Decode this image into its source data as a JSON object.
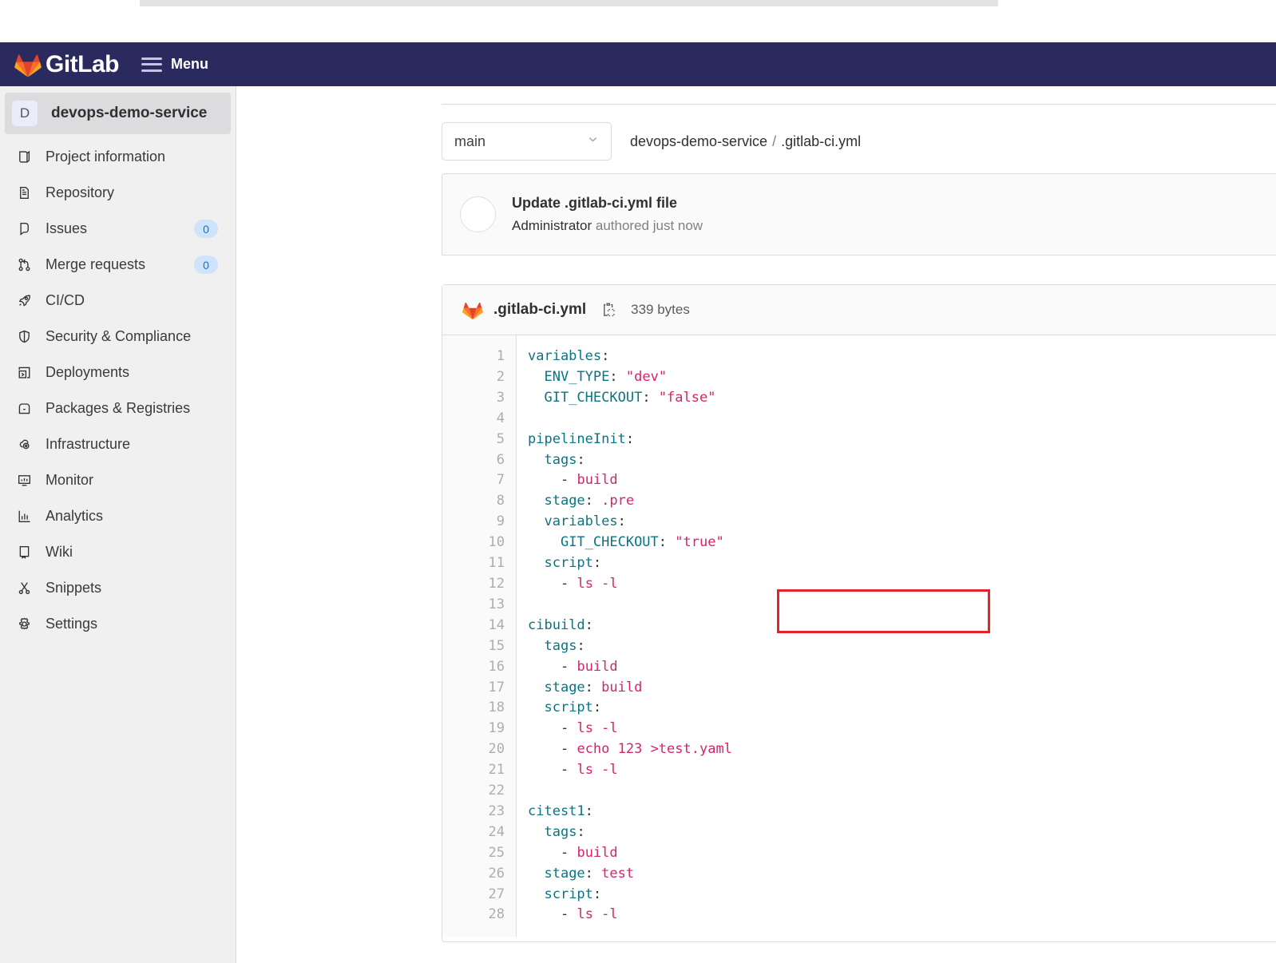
{
  "navbar": {
    "brand": "GitLab",
    "menu_label": "Menu",
    "background_color": "#2b2a5e",
    "logo_icon": "gitlab-fox-logo",
    "hamburger_icon": "hamburger-menu-icon"
  },
  "sidebar": {
    "project": {
      "avatar_initial": "D",
      "name": "devops-demo-service"
    },
    "items": [
      {
        "label": "Project information",
        "icon": "book-icon",
        "badge": null
      },
      {
        "label": "Repository",
        "icon": "document-icon",
        "badge": null
      },
      {
        "label": "Issues",
        "icon": "issue-icon",
        "badge": "0"
      },
      {
        "label": "Merge requests",
        "icon": "merge-request-icon",
        "badge": "0"
      },
      {
        "label": "CI/CD",
        "icon": "rocket-icon",
        "badge": null
      },
      {
        "label": "Security & Compliance",
        "icon": "shield-icon",
        "badge": null
      },
      {
        "label": "Deployments",
        "icon": "deployment-icon",
        "badge": null
      },
      {
        "label": "Packages & Registries",
        "icon": "package-icon",
        "badge": null
      },
      {
        "label": "Infrastructure",
        "icon": "cloud-gear-icon",
        "badge": null
      },
      {
        "label": "Monitor",
        "icon": "monitor-icon",
        "badge": null
      },
      {
        "label": "Analytics",
        "icon": "chart-icon",
        "badge": null
      },
      {
        "label": "Wiki",
        "icon": "book-wiki-icon",
        "badge": null
      },
      {
        "label": "Snippets",
        "icon": "scissors-icon",
        "badge": null
      },
      {
        "label": "Settings",
        "icon": "gear-icon",
        "badge": null
      }
    ],
    "badge_color": "#cfe3fb"
  },
  "file_nav": {
    "branch": "main",
    "chevron_icon": "chevron-down-icon",
    "breadcrumb_project": "devops-demo-service",
    "breadcrumb_separator": "/",
    "breadcrumb_file": ".gitlab-ci.yml"
  },
  "commit": {
    "title": "Update .gitlab-ci.yml file",
    "author": "Administrator",
    "meta": "authored just now",
    "avatar_icon": "user-avatar-placeholder"
  },
  "file_header": {
    "icon": "gitlab-fox-file-icon",
    "name": ".gitlab-ci.yml",
    "copy_icon": "copy-to-clipboard-icon",
    "size": "339 bytes"
  },
  "code": {
    "line_numbers": [
      "1",
      "2",
      "3",
      "4",
      "5",
      "6",
      "7",
      "8",
      "9",
      "10",
      "11",
      "12",
      "13",
      "14",
      "15",
      "16",
      "17",
      "18",
      "19",
      "20",
      "21",
      "22",
      "23",
      "24",
      "25",
      "26",
      "27",
      "28"
    ],
    "lines": [
      {
        "n": 1,
        "text": "variables:"
      },
      {
        "n": 2,
        "text": "  ENV_TYPE: \"dev\""
      },
      {
        "n": 3,
        "text": "  GIT_CHECKOUT: \"false\""
      },
      {
        "n": 4,
        "text": ""
      },
      {
        "n": 5,
        "text": "pipelineInit:"
      },
      {
        "n": 6,
        "text": "  tags:"
      },
      {
        "n": 7,
        "text": "    - build"
      },
      {
        "n": 8,
        "text": "  stage: .pre"
      },
      {
        "n": 9,
        "text": "  variables:"
      },
      {
        "n": 10,
        "text": "    GIT_CHECKOUT: \"true\""
      },
      {
        "n": 11,
        "text": "  script:"
      },
      {
        "n": 12,
        "text": "    - ls -l"
      },
      {
        "n": 13,
        "text": ""
      },
      {
        "n": 14,
        "text": "cibuild:"
      },
      {
        "n": 15,
        "text": "  tags:"
      },
      {
        "n": 16,
        "text": "    - build"
      },
      {
        "n": 17,
        "text": "  stage: build"
      },
      {
        "n": 18,
        "text": "  script:"
      },
      {
        "n": 19,
        "text": "    - ls -l"
      },
      {
        "n": 20,
        "text": "    - echo 123 >test.yaml"
      },
      {
        "n": 21,
        "text": "    - ls -l"
      },
      {
        "n": 22,
        "text": ""
      },
      {
        "n": 23,
        "text": "citest1:"
      },
      {
        "n": 24,
        "text": "  tags:"
      },
      {
        "n": 25,
        "text": "    - build"
      },
      {
        "n": 26,
        "text": "  stage: test"
      },
      {
        "n": 27,
        "text": "  script:"
      },
      {
        "n": 28,
        "text": "    - ls -l"
      }
    ],
    "syntax_colors": {
      "key": "#0b7482",
      "value": "#d6246b",
      "punctuation": "#303030",
      "line_number": "#adadad"
    }
  },
  "annotation": {
    "type": "rectangle-highlight",
    "color": "#e8202a",
    "covers_lines": [
      "9",
      "10"
    ],
    "covers_text": "variables: / GIT_CHECKOUT: \"true\""
  }
}
